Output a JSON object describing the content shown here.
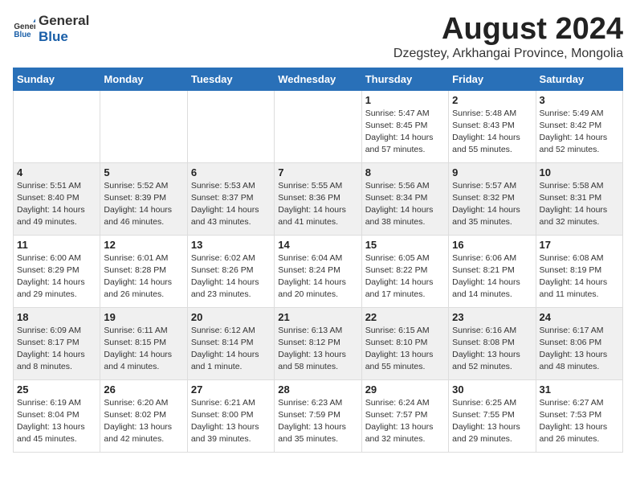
{
  "header": {
    "logo_general": "General",
    "logo_blue": "Blue",
    "month_year": "August 2024",
    "location": "Dzegstey, Arkhangai Province, Mongolia"
  },
  "days_of_week": [
    "Sunday",
    "Monday",
    "Tuesday",
    "Wednesday",
    "Thursday",
    "Friday",
    "Saturday"
  ],
  "weeks": [
    [
      {
        "day": "",
        "info": ""
      },
      {
        "day": "",
        "info": ""
      },
      {
        "day": "",
        "info": ""
      },
      {
        "day": "",
        "info": ""
      },
      {
        "day": "1",
        "info": "Sunrise: 5:47 AM\nSunset: 8:45 PM\nDaylight: 14 hours\nand 57 minutes."
      },
      {
        "day": "2",
        "info": "Sunrise: 5:48 AM\nSunset: 8:43 PM\nDaylight: 14 hours\nand 55 minutes."
      },
      {
        "day": "3",
        "info": "Sunrise: 5:49 AM\nSunset: 8:42 PM\nDaylight: 14 hours\nand 52 minutes."
      }
    ],
    [
      {
        "day": "4",
        "info": "Sunrise: 5:51 AM\nSunset: 8:40 PM\nDaylight: 14 hours\nand 49 minutes."
      },
      {
        "day": "5",
        "info": "Sunrise: 5:52 AM\nSunset: 8:39 PM\nDaylight: 14 hours\nand 46 minutes."
      },
      {
        "day": "6",
        "info": "Sunrise: 5:53 AM\nSunset: 8:37 PM\nDaylight: 14 hours\nand 43 minutes."
      },
      {
        "day": "7",
        "info": "Sunrise: 5:55 AM\nSunset: 8:36 PM\nDaylight: 14 hours\nand 41 minutes."
      },
      {
        "day": "8",
        "info": "Sunrise: 5:56 AM\nSunset: 8:34 PM\nDaylight: 14 hours\nand 38 minutes."
      },
      {
        "day": "9",
        "info": "Sunrise: 5:57 AM\nSunset: 8:32 PM\nDaylight: 14 hours\nand 35 minutes."
      },
      {
        "day": "10",
        "info": "Sunrise: 5:58 AM\nSunset: 8:31 PM\nDaylight: 14 hours\nand 32 minutes."
      }
    ],
    [
      {
        "day": "11",
        "info": "Sunrise: 6:00 AM\nSunset: 8:29 PM\nDaylight: 14 hours\nand 29 minutes."
      },
      {
        "day": "12",
        "info": "Sunrise: 6:01 AM\nSunset: 8:28 PM\nDaylight: 14 hours\nand 26 minutes."
      },
      {
        "day": "13",
        "info": "Sunrise: 6:02 AM\nSunset: 8:26 PM\nDaylight: 14 hours\nand 23 minutes."
      },
      {
        "day": "14",
        "info": "Sunrise: 6:04 AM\nSunset: 8:24 PM\nDaylight: 14 hours\nand 20 minutes."
      },
      {
        "day": "15",
        "info": "Sunrise: 6:05 AM\nSunset: 8:22 PM\nDaylight: 14 hours\nand 17 minutes."
      },
      {
        "day": "16",
        "info": "Sunrise: 6:06 AM\nSunset: 8:21 PM\nDaylight: 14 hours\nand 14 minutes."
      },
      {
        "day": "17",
        "info": "Sunrise: 6:08 AM\nSunset: 8:19 PM\nDaylight: 14 hours\nand 11 minutes."
      }
    ],
    [
      {
        "day": "18",
        "info": "Sunrise: 6:09 AM\nSunset: 8:17 PM\nDaylight: 14 hours\nand 8 minutes."
      },
      {
        "day": "19",
        "info": "Sunrise: 6:11 AM\nSunset: 8:15 PM\nDaylight: 14 hours\nand 4 minutes."
      },
      {
        "day": "20",
        "info": "Sunrise: 6:12 AM\nSunset: 8:14 PM\nDaylight: 14 hours\nand 1 minute."
      },
      {
        "day": "21",
        "info": "Sunrise: 6:13 AM\nSunset: 8:12 PM\nDaylight: 13 hours\nand 58 minutes."
      },
      {
        "day": "22",
        "info": "Sunrise: 6:15 AM\nSunset: 8:10 PM\nDaylight: 13 hours\nand 55 minutes."
      },
      {
        "day": "23",
        "info": "Sunrise: 6:16 AM\nSunset: 8:08 PM\nDaylight: 13 hours\nand 52 minutes."
      },
      {
        "day": "24",
        "info": "Sunrise: 6:17 AM\nSunset: 8:06 PM\nDaylight: 13 hours\nand 48 minutes."
      }
    ],
    [
      {
        "day": "25",
        "info": "Sunrise: 6:19 AM\nSunset: 8:04 PM\nDaylight: 13 hours\nand 45 minutes."
      },
      {
        "day": "26",
        "info": "Sunrise: 6:20 AM\nSunset: 8:02 PM\nDaylight: 13 hours\nand 42 minutes."
      },
      {
        "day": "27",
        "info": "Sunrise: 6:21 AM\nSunset: 8:00 PM\nDaylight: 13 hours\nand 39 minutes."
      },
      {
        "day": "28",
        "info": "Sunrise: 6:23 AM\nSunset: 7:59 PM\nDaylight: 13 hours\nand 35 minutes."
      },
      {
        "day": "29",
        "info": "Sunrise: 6:24 AM\nSunset: 7:57 PM\nDaylight: 13 hours\nand 32 minutes."
      },
      {
        "day": "30",
        "info": "Sunrise: 6:25 AM\nSunset: 7:55 PM\nDaylight: 13 hours\nand 29 minutes."
      },
      {
        "day": "31",
        "info": "Sunrise: 6:27 AM\nSunset: 7:53 PM\nDaylight: 13 hours\nand 26 minutes."
      }
    ]
  ]
}
